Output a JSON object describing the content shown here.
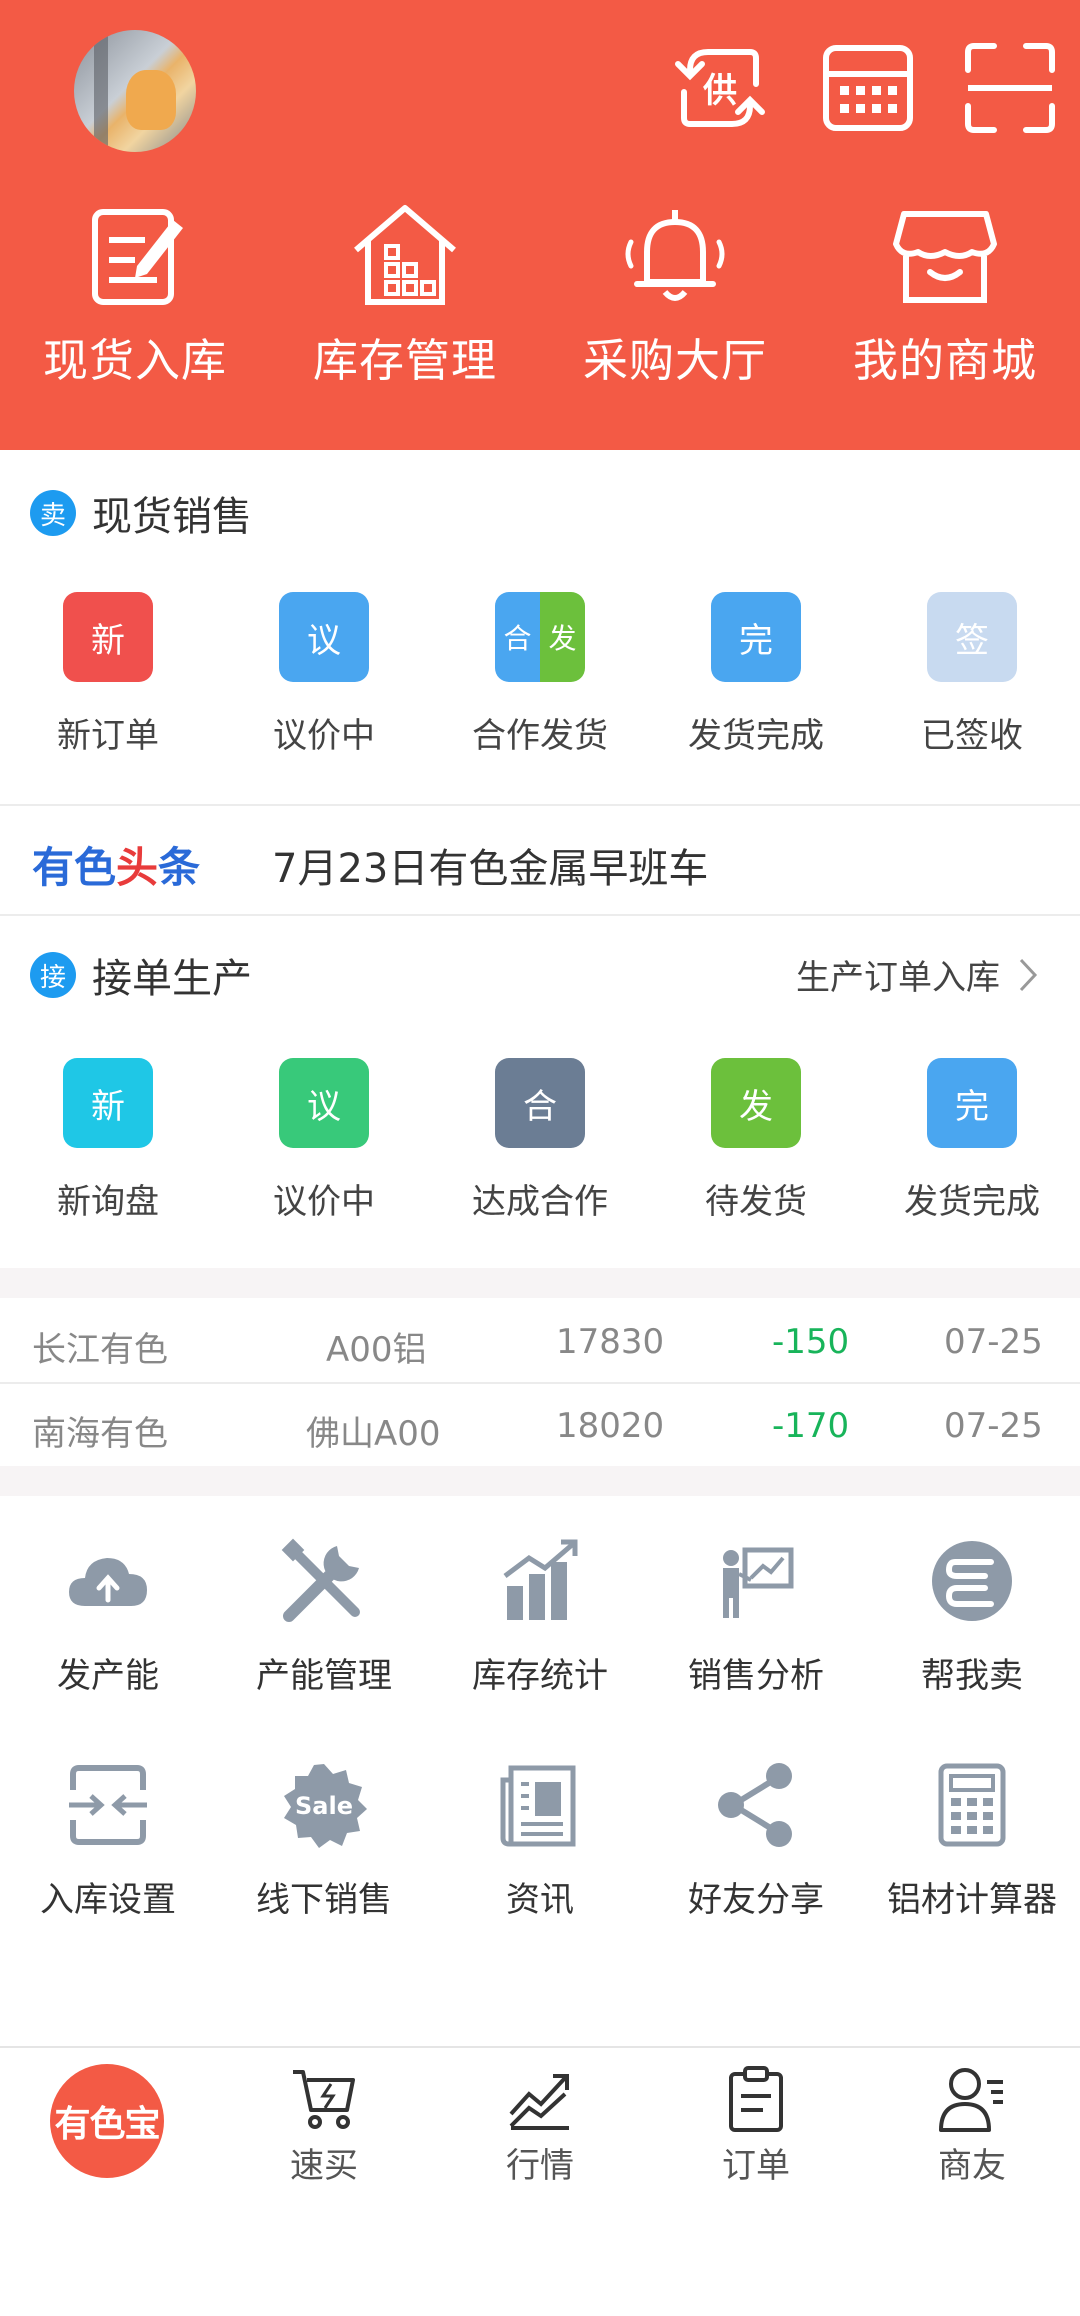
{
  "header": {
    "quick": [
      {
        "label": "现货入库",
        "icon": "edit-document-icon"
      },
      {
        "label": "库存管理",
        "icon": "warehouse-icon"
      },
      {
        "label": "采购大厅",
        "icon": "bell-icon"
      },
      {
        "label": "我的商城",
        "icon": "store-icon"
      }
    ],
    "supply_badge": "供",
    "icons": [
      "supply-switch-icon",
      "calculator-icon",
      "scan-icon"
    ]
  },
  "sales": {
    "badge": "卖",
    "title": "现货销售",
    "items": [
      {
        "glyph": "新",
        "label": "新订单",
        "color": "#f0504d"
      },
      {
        "glyph": "议",
        "label": "议价中",
        "color": "#4aa6f0"
      },
      {
        "glyph_left": "合",
        "glyph_right": "发",
        "label": "合作发货",
        "color_left": "#4aa6f0",
        "color_right": "#6cc03c"
      },
      {
        "glyph": "完",
        "label": "发货完成",
        "color": "#4aa6f0"
      },
      {
        "glyph": "签",
        "label": "已签收",
        "color": "#c8daf0"
      }
    ]
  },
  "news": {
    "brand_1": "有色",
    "brand_2": "头",
    "brand_3": "条",
    "headline": "7月23日有色金属早班车"
  },
  "production": {
    "badge": "接",
    "title": "接单生产",
    "link": "生产订单入库",
    "items": [
      {
        "glyph": "新",
        "label": "新询盘",
        "color": "#1fc7e6"
      },
      {
        "glyph": "议",
        "label": "议价中",
        "color": "#38c97a"
      },
      {
        "glyph": "合",
        "label": "达成合作",
        "color": "#6b7d94"
      },
      {
        "glyph": "发",
        "label": "待发货",
        "color": "#6cc03c"
      },
      {
        "glyph": "完",
        "label": "发货完成",
        "color": "#4aa6f0"
      }
    ]
  },
  "prices": [
    {
      "market": "长江有色",
      "product": "A00铝",
      "price": "17830",
      "change": "-150",
      "date": "07-25"
    },
    {
      "market": "南海有色",
      "product": "佛山A00",
      "price": "18020",
      "change": "-170",
      "date": "07-25"
    }
  ],
  "tools": [
    {
      "label": "发产能",
      "icon": "cloud-upload-icon"
    },
    {
      "label": "产能管理",
      "icon": "tools-icon"
    },
    {
      "label": "库存统计",
      "icon": "bar-chart-icon"
    },
    {
      "label": "销售分析",
      "icon": "presentation-icon"
    },
    {
      "label": "帮我卖",
      "icon": "sell-icon"
    },
    {
      "label": "入库设置",
      "icon": "merge-arrows-icon"
    },
    {
      "label": "线下销售",
      "icon": "sale-badge-icon",
      "badge_text": "Sale"
    },
    {
      "label": "资讯",
      "icon": "newspaper-icon"
    },
    {
      "label": "好友分享",
      "icon": "share-icon"
    },
    {
      "label": "铝材计算器",
      "icon": "calculator-icon"
    }
  ],
  "bottom_nav": [
    {
      "label": "有色宝",
      "icon": "home-logo"
    },
    {
      "label": "速买",
      "icon": "cart-icon"
    },
    {
      "label": "行情",
      "icon": "trend-icon"
    },
    {
      "label": "订单",
      "icon": "clipboard-icon"
    },
    {
      "label": "商友",
      "icon": "contacts-icon"
    }
  ],
  "colors": {
    "brand": "#f35a45",
    "down": "#18b45a",
    "icon_gray": "#8e9aa8"
  }
}
